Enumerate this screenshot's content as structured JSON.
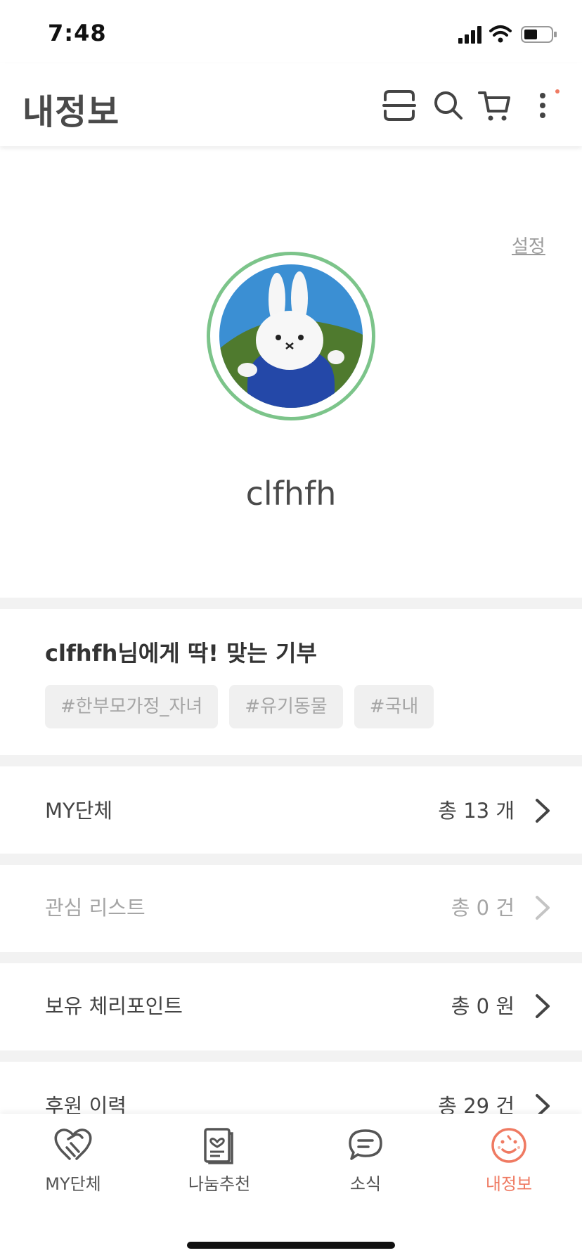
{
  "status_bar": {
    "time": "7:48"
  },
  "header": {
    "title": "내정보",
    "icons": [
      "scan-icon",
      "search-icon",
      "cart-icon",
      "more-icon"
    ]
  },
  "profile": {
    "settings_label": "설정",
    "username": "clfhfh"
  },
  "recommendation": {
    "title": "clfhfh님에게 딱! 맞는 기부",
    "tags": [
      "#한부모가정_자녀",
      "#유기동물",
      "#국내"
    ]
  },
  "rows": [
    {
      "label": "MY단체",
      "value": "총 13 개"
    },
    {
      "label": "관심 리스트",
      "value": "총 0 건"
    },
    {
      "label": "보유 체리포인트",
      "value": "총 0 원"
    },
    {
      "label": "후원 이력",
      "value": "총 29 건"
    }
  ],
  "tabs": [
    {
      "label": "MY단체",
      "icon": "handshake-icon"
    },
    {
      "label": "나눔추천",
      "icon": "book-icon"
    },
    {
      "label": "소식",
      "icon": "chat-icon"
    },
    {
      "label": "내정보",
      "icon": "smile-icon"
    }
  ],
  "colors": {
    "accent": "#ef7a62",
    "avatar_ring": "#7cc48a",
    "separator": "#f2f2f2"
  }
}
